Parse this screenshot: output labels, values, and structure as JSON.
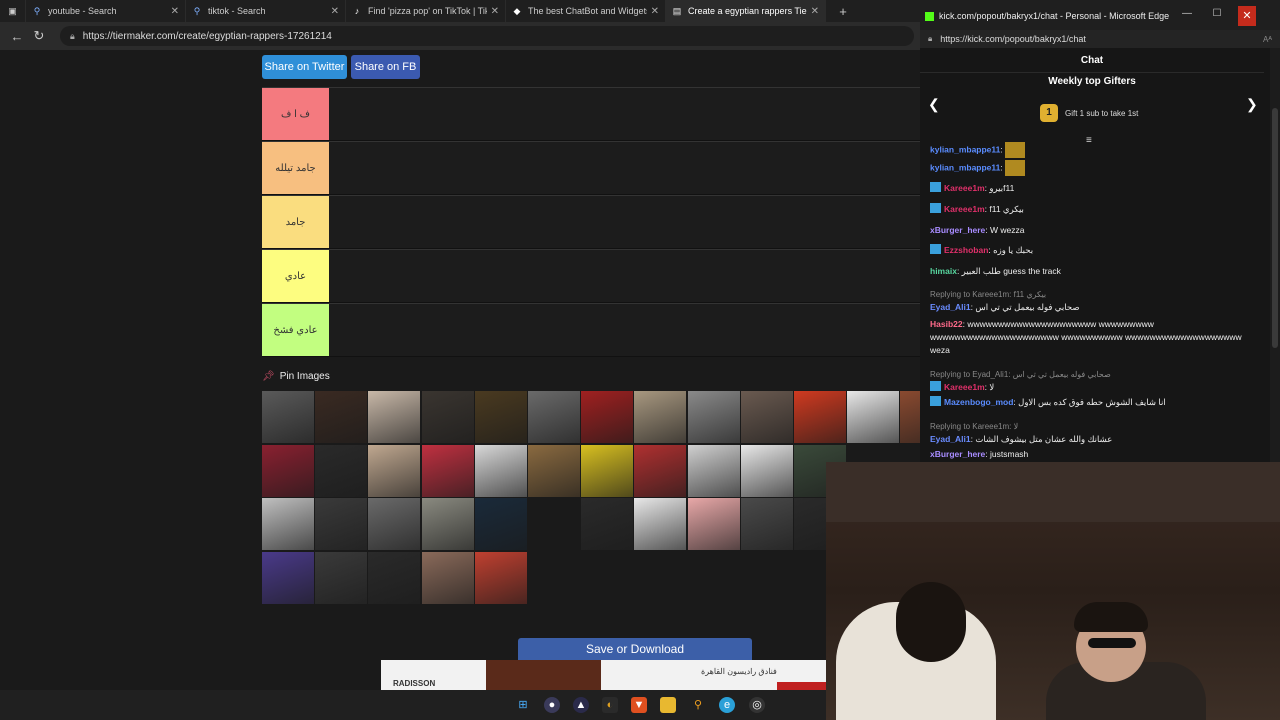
{
  "browser": {
    "tabs": [
      {
        "title": "youtube - Search",
        "icon": "search-icon"
      },
      {
        "title": "tiktok - Search",
        "icon": "search-icon"
      },
      {
        "title": "Find 'pizza pop' on TikTok | TikTok",
        "icon": "tiktok-icon"
      },
      {
        "title": "The best ChatBot and Widgets for",
        "icon": "bot-icon"
      },
      {
        "title": "Create a egyptian rappers Tier List",
        "icon": "tiermaker-icon"
      }
    ],
    "url": "https://tiermaker.com/create/egyptian-rappers-17261214"
  },
  "page": {
    "share_twitter": "Share on Twitter",
    "share_fb": "Share on FB",
    "tiers": [
      {
        "label": "ف ا ف",
        "color": "#f47a7f"
      },
      {
        "label": "جامد تيلله",
        "color": "#f7bf80"
      },
      {
        "label": "جامد",
        "color": "#fadd7f"
      },
      {
        "label": "عادي",
        "color": "#fdfd80"
      },
      {
        "label": "عادي فشخ",
        "color": "#c2fe80"
      }
    ],
    "pin_label": "Pin Images",
    "save_button": "Save or Download",
    "ad": {
      "brand": "RADISSON",
      "text": "فنادق راديسون القاهرة"
    }
  },
  "popup": {
    "title": "kick.com/popout/bakryx1/chat - Personal - Microsoft Edge",
    "url": "https://kick.com/popout/bakryx1/chat",
    "chat_header": "Chat",
    "gifters_title": "Weekly top Gifters",
    "gift_rank": "1",
    "gift_text": "Gift 1 sub to take 1st",
    "messages": [
      {
        "user": "kylian_mbappe11",
        "color": "#5a8cff",
        "text": "",
        "emote": true,
        "badge": false
      },
      {
        "user": "kylian_mbappe11",
        "color": "#5a8cff",
        "text": "",
        "emote": true,
        "badge": false
      },
      {
        "user": "Kareee1m",
        "color": "#e0306a",
        "text": "بيروf11",
        "badge": true
      },
      {
        "user": "Kareee1m",
        "color": "#e0306a",
        "text": "f11 بيكري",
        "badge": true
      },
      {
        "user": "xBurger_here",
        "color": "#a88cff",
        "text": "W wezza",
        "badge": false
      },
      {
        "user": "Ezzshoban",
        "color": "#e0306a",
        "text": "بحبك يا وزه",
        "badge": true
      },
      {
        "user": "himaix",
        "color": "#58d8a0",
        "text": "طلب العبير guess the track",
        "badge": false
      },
      {
        "user": "Eyad_Ali1",
        "color": "#6a8cff",
        "text": "صحابي فوله بيعمل تي تي اس",
        "badge": false,
        "reply": "Replying to Kareee1m: f11 بيكري"
      },
      {
        "user": "Hasib22",
        "color": "#ff6a8a",
        "text": "wwwwwwwwwwwwwwwwwwwww wwwwwwwww wwwwwwwwwwwwwwwwwwwww wwwwwwwwww wwwwwwwwwwwwwwwwwww weza",
        "badge": false
      },
      {
        "user": "Kareee1m",
        "color": "#e0306a",
        "text": "لا",
        "badge": true,
        "reply": "Replying to Eyad_Ali1: صحابي فوله بيعمل تي تي اس"
      },
      {
        "user": "Mazenbogo_mod",
        "color": "#5a8cff",
        "text": "انا شايف الشوش حطه فوق كده بس الاول",
        "badge": true
      },
      {
        "user": "Eyad_Ali1",
        "color": "#6a8cff",
        "text": "عشانك والله عشان متل بيشوف الشات",
        "badge": false,
        "reply": "Replying to Kareee1m: لا"
      },
      {
        "user": "xBurger_here",
        "color": "#a88cff",
        "text": "justsmash",
        "badge": false
      }
    ]
  },
  "images": [
    "#5a5a5a",
    "#3a2a22",
    "#c8b8a8",
    "#3a3530",
    "#4a3a20",
    "#6a6a6a",
    "#a02020",
    "#a89880",
    "#8a8a8a",
    "#6a5a50",
    "#d03a20",
    "#e8e8e8",
    "#8a4a30",
    "#8a2030",
    "#2a2a2a",
    "#c0a890",
    "#c03040",
    "#d8d8d8",
    "#8a6a40",
    "#d8c020",
    "#b03030",
    "#d0d0d0",
    "#e8e8e8",
    "#3a4a3a",
    "#c0c0c0",
    "#3a3a3a",
    "#6a6a6a",
    "#8a8a80",
    "#1a2a3a",
    "#1a1a1a",
    "#2a2a2a",
    "#e8e8e8",
    "#e8a8a8",
    "#4a4a4a",
    "#2a2a2a",
    "#4a3a8a",
    "#3a3a3a",
    "#2a2a2a",
    "#8a6a5a",
    "#c04030"
  ]
}
